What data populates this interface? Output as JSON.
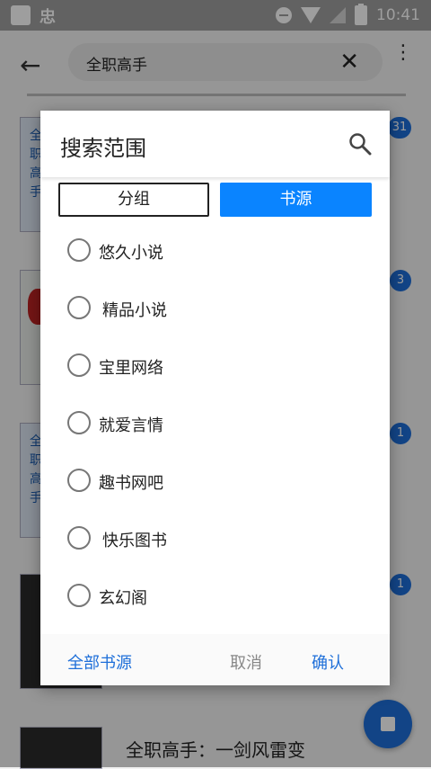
{
  "status_bar": {
    "app_glyph": "忠",
    "time": "10:41"
  },
  "app_bar": {
    "search_query": "全职高手"
  },
  "list": {
    "covers": [
      {
        "text": "全职高手",
        "badge": "31"
      },
      {
        "text": "",
        "badge": "3"
      },
      {
        "text": "全职高手",
        "badge": "1"
      },
      {
        "text": "",
        "badge": "1"
      }
    ],
    "last_title": "全职高手：一剑风雷变"
  },
  "dialog": {
    "title": "搜索范围",
    "segments": {
      "group": "分组",
      "source": "书源"
    },
    "options": [
      "悠久小说",
      "精品小说",
      "宝里网络",
      "就爱言情",
      "趣书网吧",
      "快乐图书",
      "玄幻阁"
    ],
    "footer": {
      "all_sources": "全部书源",
      "cancel": "取消",
      "confirm": "确认"
    }
  },
  "colors": {
    "accent": "#0a84ff",
    "link": "#1e6fd9"
  }
}
